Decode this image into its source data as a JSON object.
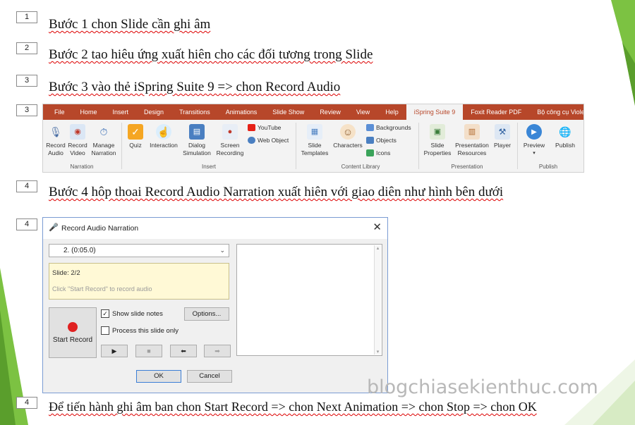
{
  "steps": [
    {
      "num": "1",
      "text": "Bước 1 chon Slide cần ghi âm"
    },
    {
      "num": "2",
      "text": "Bước 2 tao hiêu ứng xuất hiên cho các đối tương trong Slide"
    },
    {
      "num": "3",
      "text": "Bước 3 vào thẻ iSpring Suite 9 => chon Record Audio"
    },
    {
      "num": "3"
    },
    {
      "num": "4",
      "text": "Bước 4 hôp thoai Record Audio Narration xuất hiên với giao diên như hình bên dưới"
    },
    {
      "num": "4"
    },
    {
      "num": "4",
      "text": "Để tiến hành ghi âm ban chon Start Record => chon Next Animation => chon Stop => chon OK"
    }
  ],
  "ribbon": {
    "tabs": [
      "File",
      "Home",
      "Insert",
      "Design",
      "Transitions",
      "Animations",
      "Slide Show",
      "Review",
      "View",
      "Help",
      "iSpring Suite 9",
      "Foxit Reader PDF",
      "Bộ công cụ Violet"
    ],
    "buttons": {
      "record_audio": "Record\nAudio",
      "record_video": "Record\nVideo",
      "manage_narration": "Manage\nNarration",
      "quiz": "Quiz",
      "interaction": "Interaction",
      "dialog_sim": "Dialog\nSimulation",
      "screen_rec": "Screen\nRecording",
      "youtube": "YouTube",
      "web_object": "Web Object",
      "slide_templates": "Slide\nTemplates",
      "characters": "Characters",
      "backgrounds": "Backgrounds",
      "objects": "Objects",
      "icons": "Icons",
      "slide_props": "Slide\nProperties",
      "pres_resources": "Presentation\nResources",
      "player": "Player",
      "preview": "Preview",
      "publish": "Publish"
    },
    "groups": {
      "narration": "Narration",
      "insert": "Insert",
      "content_library": "Content Library",
      "presentation": "Presentation",
      "publish": "Publish"
    }
  },
  "dialog": {
    "title": "Record Audio Narration",
    "combo_value": "2. (0:05.0)",
    "notes_slide": "Slide: 2/2",
    "notes_hint": "Click \"Start Record\" to record audio",
    "start_record": "Start Record",
    "show_notes": "Show slide notes",
    "show_notes_checked": true,
    "process_only": "Process this slide only",
    "process_only_checked": false,
    "options": "Options...",
    "ok": "OK",
    "cancel": "Cancel"
  },
  "watermark": "blogchiasekienthuc.com",
  "colors": {
    "ribbon_accent": "#b7472a",
    "green_decoration": "#7cc242",
    "record_dot": "#e02020"
  }
}
